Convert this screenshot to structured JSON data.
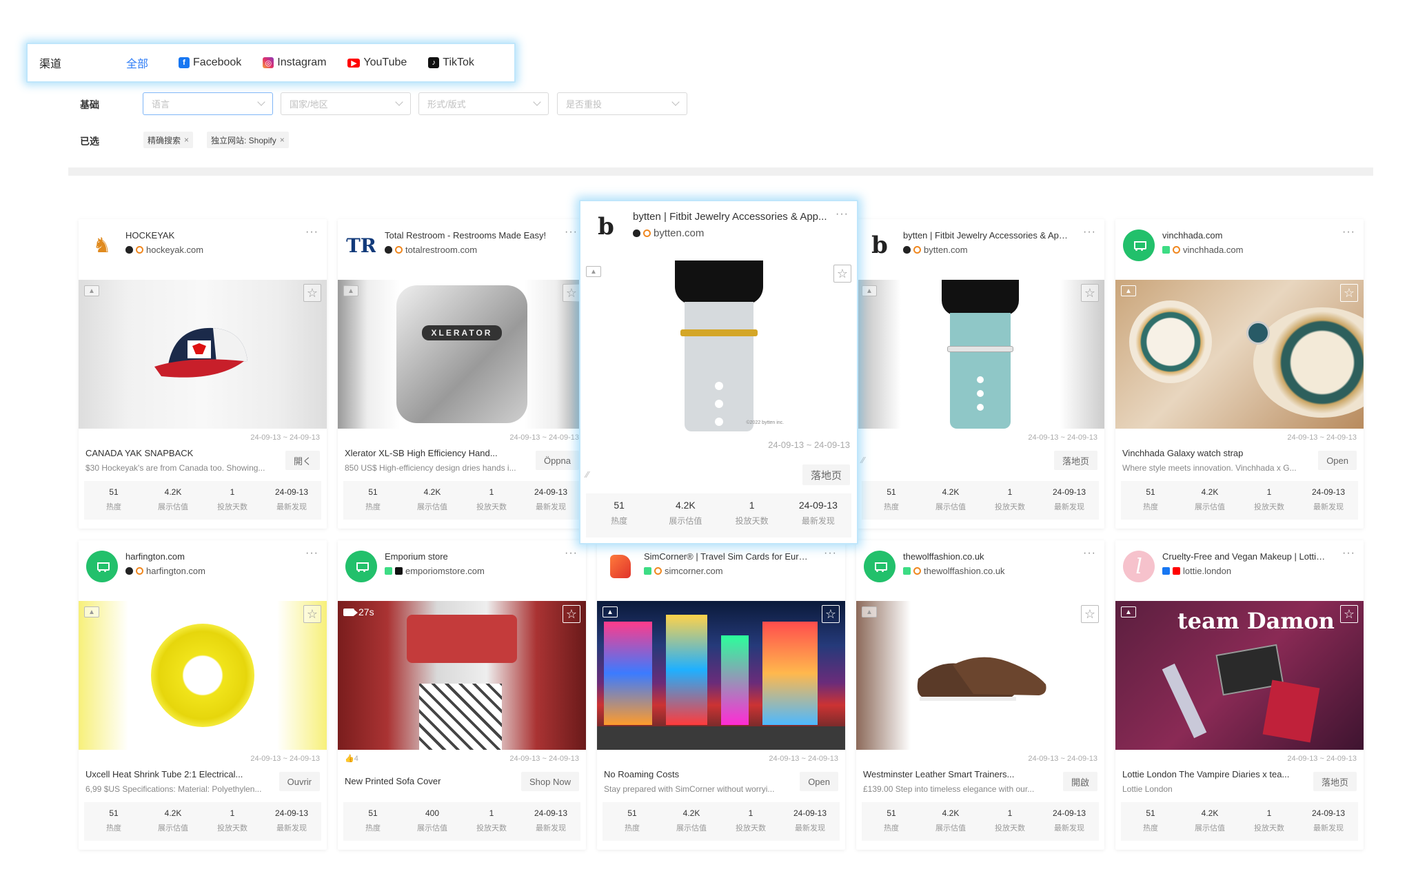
{
  "filters": {
    "channel_label": "渠道",
    "channels": [
      {
        "label": "全部",
        "active": true,
        "icon": ""
      },
      {
        "label": "Facebook",
        "active": false,
        "icon": "facebook-icon"
      },
      {
        "label": "Instagram",
        "active": false,
        "icon": "instagram-icon"
      },
      {
        "label": "YouTube",
        "active": false,
        "icon": "youtube-icon"
      },
      {
        "label": "TikTok",
        "active": false,
        "icon": "tiktok-icon"
      }
    ],
    "basic_label": "基础",
    "selects": [
      "语言",
      "国家/地区",
      "形式/版式",
      "是否重投"
    ],
    "selected_label": "已选",
    "tags": [
      "精确搜索",
      "独立网站: Shopify"
    ]
  },
  "stat_labels": [
    "热度",
    "展示估值",
    "投放天数",
    "最新发现"
  ],
  "cards": [
    {
      "title": "HOCKEYAK",
      "domain": "hockeyak.com",
      "platforms": [
        "apple",
        "ring"
      ],
      "date_range": "24-09-13 ~ 24-09-13",
      "ad_title": "CANADA YAK SNAPBACK",
      "ad_sub": "$30 Hockeyak's are from Canada too. Showing...",
      "cta": "開く",
      "stats": [
        "51",
        "4.2K",
        "1",
        "24-09-13"
      ]
    },
    {
      "title": "Total Restroom - Restrooms Made Easy!",
      "domain": "totalrestroom.com",
      "platforms": [
        "apple",
        "ring"
      ],
      "date_range": "24-09-13 ~ 24-09-13",
      "ad_title": "Xlerator XL-SB High Efficiency Hand...",
      "ad_sub": "850 US$ High-efficiency design dries hands i...",
      "cta": "Öppna",
      "stats": [
        "51",
        "4.2K",
        "1",
        "24-09-13"
      ],
      "media_text": "XLERATOR"
    },
    {
      "title": "bytten | Fitbit Jewelry Accessories & App...",
      "domain": "bytten.com",
      "platforms": [
        "apple",
        "ring"
      ],
      "date_range": "24-09-13 ~ 24-09-13",
      "ad_title": "",
      "ad_sub": "",
      "cta": "落地页",
      "stats": [
        "51",
        "4.2K",
        "1",
        "24-09-13"
      ],
      "media_text": "©2022 bytten inc."
    },
    {
      "title": "bytten | Fitbit Jewelry Accessories & App...",
      "domain": "bytten.com",
      "platforms": [
        "apple",
        "ring"
      ],
      "date_range": "24-09-13 ~ 24-09-13",
      "ad_title": "",
      "ad_sub": "",
      "cta": "落地页",
      "stats": [
        "51",
        "4.2K",
        "1",
        "24-09-13"
      ]
    },
    {
      "title": "vinchhada.com",
      "domain": "vinchhada.com",
      "platforms": [
        "android",
        "ring"
      ],
      "date_range": "24-09-13 ~ 24-09-13",
      "ad_title": "Vinchhada Galaxy watch strap",
      "ad_sub": "Where style meets innovation. Vinchhada x G...",
      "cta": "Open",
      "stats": [
        "51",
        "4.2K",
        "1",
        "24-09-13"
      ]
    },
    {
      "title": "harfington.com",
      "domain": "harfington.com",
      "platforms": [
        "apple",
        "ring"
      ],
      "date_range": "24-09-13 ~ 24-09-13",
      "ad_title": "Uxcell Heat Shrink Tube 2:1 Electrical...",
      "ad_sub": "6,99 $US Specifications: Material: Polyethylen...",
      "cta": "Ouvrir",
      "stats": [
        "51",
        "4.2K",
        "1",
        "24-09-13"
      ]
    },
    {
      "title": "Emporium store",
      "domain": "emporiomstore.com",
      "platforms": [
        "android",
        "tiktok"
      ],
      "date_range": "24-09-13 ~ 24-09-13",
      "video": "27s",
      "likes": "4",
      "ad_title": "New Printed Sofa Cover",
      "ad_sub": "",
      "cta": "Shop Now",
      "stats": [
        "51",
        "400",
        "1",
        "24-09-13"
      ]
    },
    {
      "title": "SimCorner® | Travel Sim Cards for Europ...",
      "domain": "simcorner.com",
      "platforms": [
        "android",
        "ring"
      ],
      "date_range": "24-09-13 ~ 24-09-13",
      "ad_title": "No Roaming Costs",
      "ad_sub": "Stay prepared with SimCorner without worryi...",
      "cta": "Open",
      "stats": [
        "51",
        "4.2K",
        "1",
        "24-09-13"
      ]
    },
    {
      "title": "thewolffashion.co.uk",
      "domain": "thewolffashion.co.uk",
      "platforms": [
        "android",
        "ring"
      ],
      "date_range": "24-09-13 ~ 24-09-13",
      "ad_title": "Westminster Leather Smart Trainers...",
      "ad_sub": "£139.00 Step into timeless elegance with our...",
      "cta": "開啟",
      "stats": [
        "51",
        "4.2K",
        "1",
        "24-09-13"
      ]
    },
    {
      "title": "Cruelty-Free and Vegan Makeup | Lottie ...",
      "domain": "lottie.london",
      "platforms": [
        "meta",
        "youtube"
      ],
      "date_range": "24-09-13 ~ 24-09-13",
      "ad_title": "Lottie London The Vampire Diaries x tea...",
      "ad_sub": "Lottie London",
      "cta": "落地页",
      "stats": [
        "51",
        "4.2K",
        "1",
        "24-09-13"
      ],
      "media_text": "team Damon"
    }
  ]
}
